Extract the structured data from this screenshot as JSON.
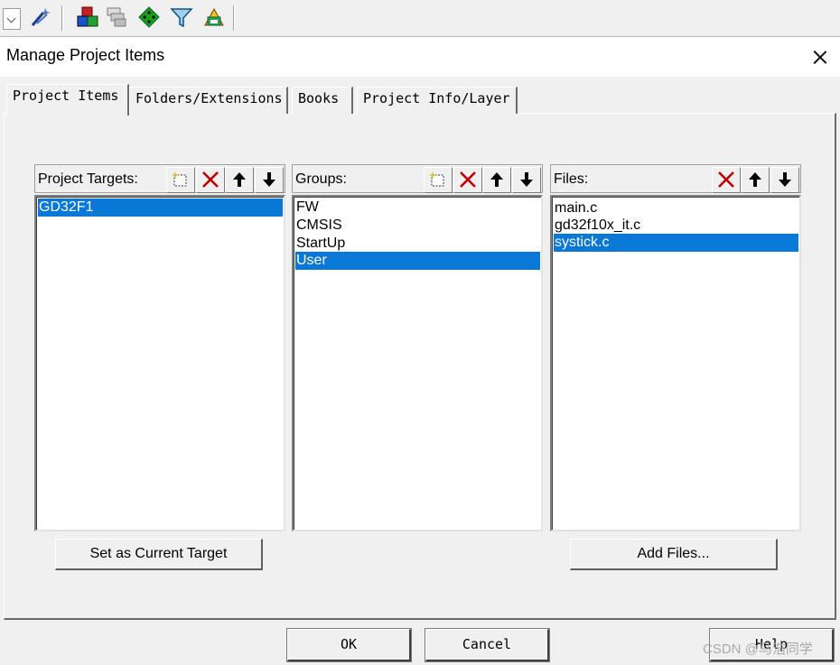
{
  "toolbar": {
    "icons": [
      "dropdown-arrow-icon",
      "magic-wand-icon",
      "components-icon",
      "layers-icon",
      "green-diamond-icon",
      "funnel-icon",
      "books-stack-icon"
    ]
  },
  "dialog": {
    "title": "Manage Project Items",
    "tabs": [
      {
        "label": "Project Items",
        "active": true
      },
      {
        "label": "Folders/Extensions",
        "active": false
      },
      {
        "label": "Books",
        "active": false
      },
      {
        "label": "Project Info/Layer",
        "active": false
      }
    ],
    "targets": {
      "header": "Project Targets:",
      "items": [
        {
          "label": "GD32F1",
          "selected": true
        }
      ],
      "button": "Set as Current Target"
    },
    "groups": {
      "header": "Groups:",
      "items": [
        {
          "label": "FW",
          "selected": false
        },
        {
          "label": "CMSIS",
          "selected": false
        },
        {
          "label": "StartUp",
          "selected": false
        },
        {
          "label": "User",
          "selected": true
        }
      ]
    },
    "files": {
      "header": "Files:",
      "items": [
        {
          "label": "main.c",
          "selected": false
        },
        {
          "label": "gd32f10x_it.c",
          "selected": false
        },
        {
          "label": "systick.c",
          "selected": true
        }
      ],
      "button": "Add Files..."
    },
    "buttons": {
      "ok": "OK",
      "cancel": "Cancel",
      "help": "Help"
    }
  },
  "colors": {
    "selection": "#0a78d7",
    "delete": "#c00000"
  },
  "watermark": "CSDN @马浩同学"
}
